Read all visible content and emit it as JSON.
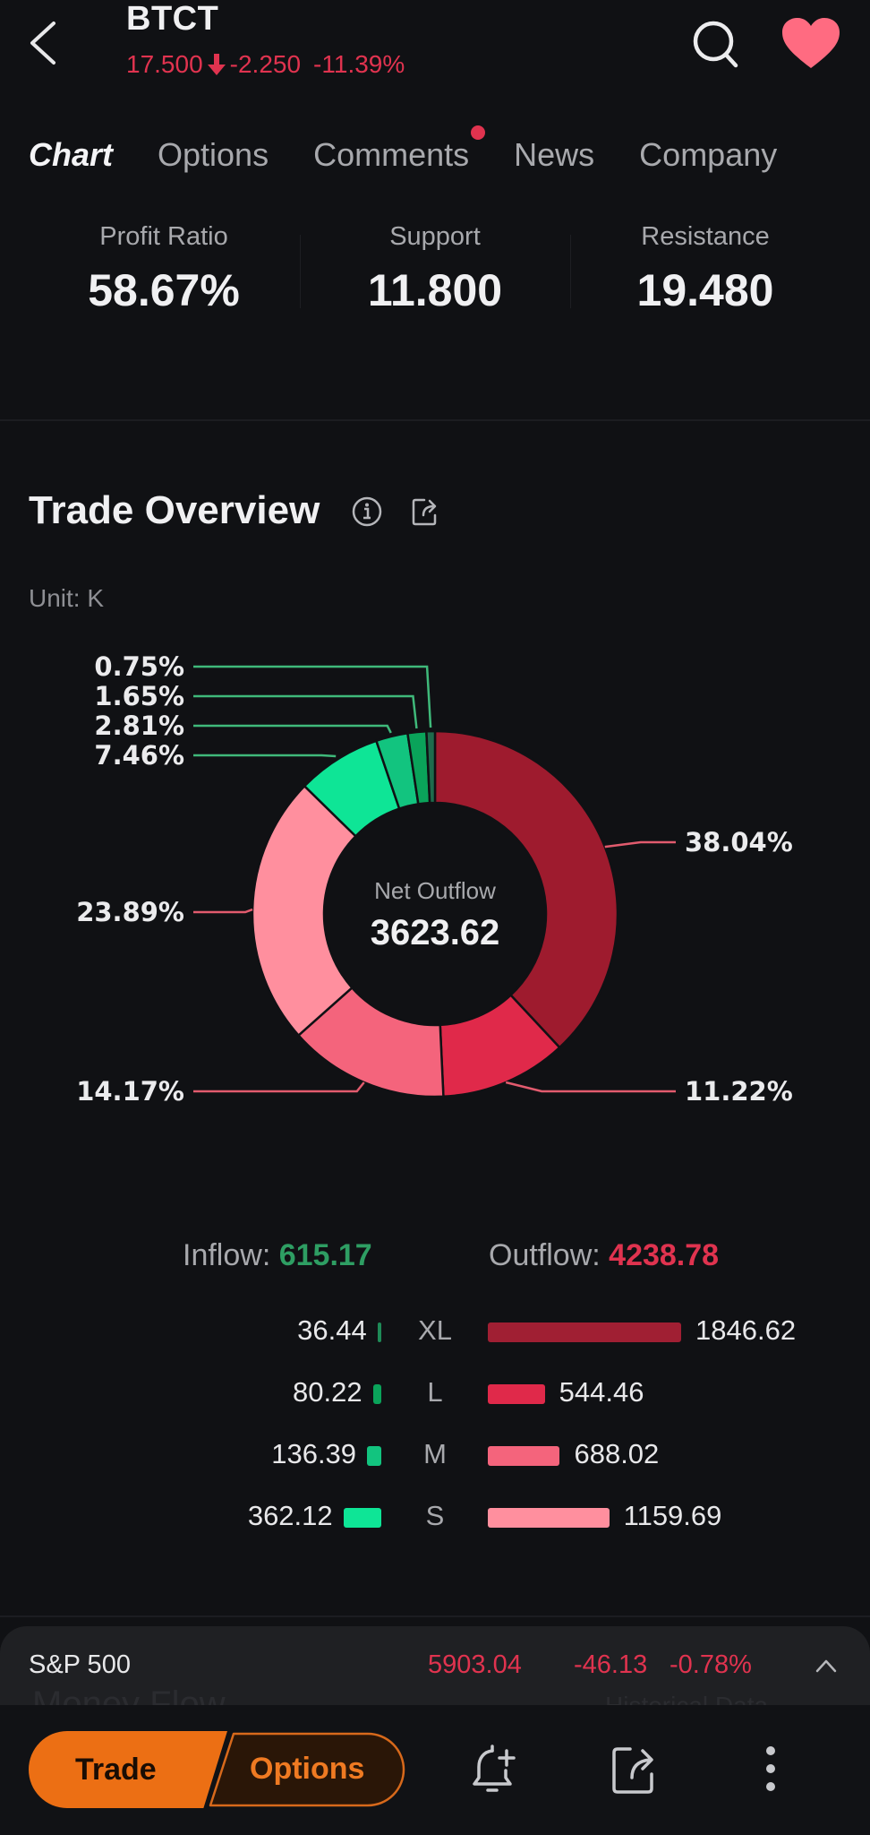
{
  "header": {
    "ticker": "BTCT",
    "price": "17.500",
    "change": "-2.250",
    "change_pct": "-11.39%",
    "direction": "down",
    "favorited": true
  },
  "tabs": [
    {
      "label": "Chart",
      "active": true
    },
    {
      "label": "Options",
      "active": false
    },
    {
      "label": "Comments",
      "active": false,
      "badge_dot": true
    },
    {
      "label": "News",
      "active": false
    },
    {
      "label": "Company",
      "active": false
    }
  ],
  "stats": [
    {
      "label": "Profit Ratio",
      "value": "58.67%"
    },
    {
      "label": "Support",
      "value": "11.800"
    },
    {
      "label": "Resistance",
      "value": "19.480"
    }
  ],
  "trade_overview": {
    "title": "Trade Overview",
    "unit": "Unit: K",
    "center_label": "Net Outflow",
    "center_value": "3623.62",
    "inflow_label": "Inflow:",
    "inflow_total": "615.17",
    "outflow_label": "Outflow:",
    "outflow_total": "4238.78",
    "rows": [
      {
        "size": "XL",
        "inflow": "36.44",
        "outflow": "1846.62"
      },
      {
        "size": "L",
        "inflow": "80.22",
        "outflow": "544.46"
      },
      {
        "size": "M",
        "inflow": "136.39",
        "outflow": "688.02"
      },
      {
        "size": "S",
        "inflow": "362.12",
        "outflow": "1159.69"
      }
    ]
  },
  "chart_data": {
    "type": "pie",
    "title": "Trade Overview",
    "subtitle": "Unit: K",
    "donut": true,
    "center_text": [
      "Net Outflow",
      "3623.62"
    ],
    "slices": [
      {
        "name": "Outflow XL",
        "value": 1846.62,
        "pct": 38.04,
        "label": "38.04%",
        "color": "#9e1b2e"
      },
      {
        "name": "Outflow L",
        "value": 544.46,
        "pct": 11.22,
        "label": "11.22%",
        "color": "#e0294a"
      },
      {
        "name": "Outflow M",
        "value": 688.02,
        "pct": 14.17,
        "label": "14.17%",
        "color": "#f4647c"
      },
      {
        "name": "Outflow S",
        "value": 1159.69,
        "pct": 23.89,
        "label": "23.89%",
        "color": "#ff8f9e"
      },
      {
        "name": "Inflow S",
        "value": 362.12,
        "pct": 7.46,
        "label": "7.46%",
        "color": "#0ee596"
      },
      {
        "name": "Inflow M",
        "value": 136.39,
        "pct": 2.81,
        "label": "2.81%",
        "color": "#12c47f"
      },
      {
        "name": "Inflow L",
        "value": 80.22,
        "pct": 1.65,
        "label": "1.65%",
        "color": "#0aa35a"
      },
      {
        "name": "Inflow XL",
        "value": 36.44,
        "pct": 0.75,
        "label": "0.75%",
        "color": "#1e6b4c"
      }
    ],
    "start": "12 o'clock",
    "direction": "clockwise"
  },
  "market_bar": {
    "name": "S&P 500",
    "price": "5903.04",
    "change": "-46.13",
    "change_pct": "-0.78%",
    "ghost_left": "Money Flow",
    "ghost_right": "Historical Data"
  },
  "bottom_nav": {
    "trade_label": "Trade",
    "options_label": "Options"
  },
  "colors": {
    "background": "#101114",
    "up_green": "#2e9e63",
    "down_red": "#e0334f",
    "accent_orange": "#ec6f14",
    "favorite_pink": "#ff6b81"
  }
}
